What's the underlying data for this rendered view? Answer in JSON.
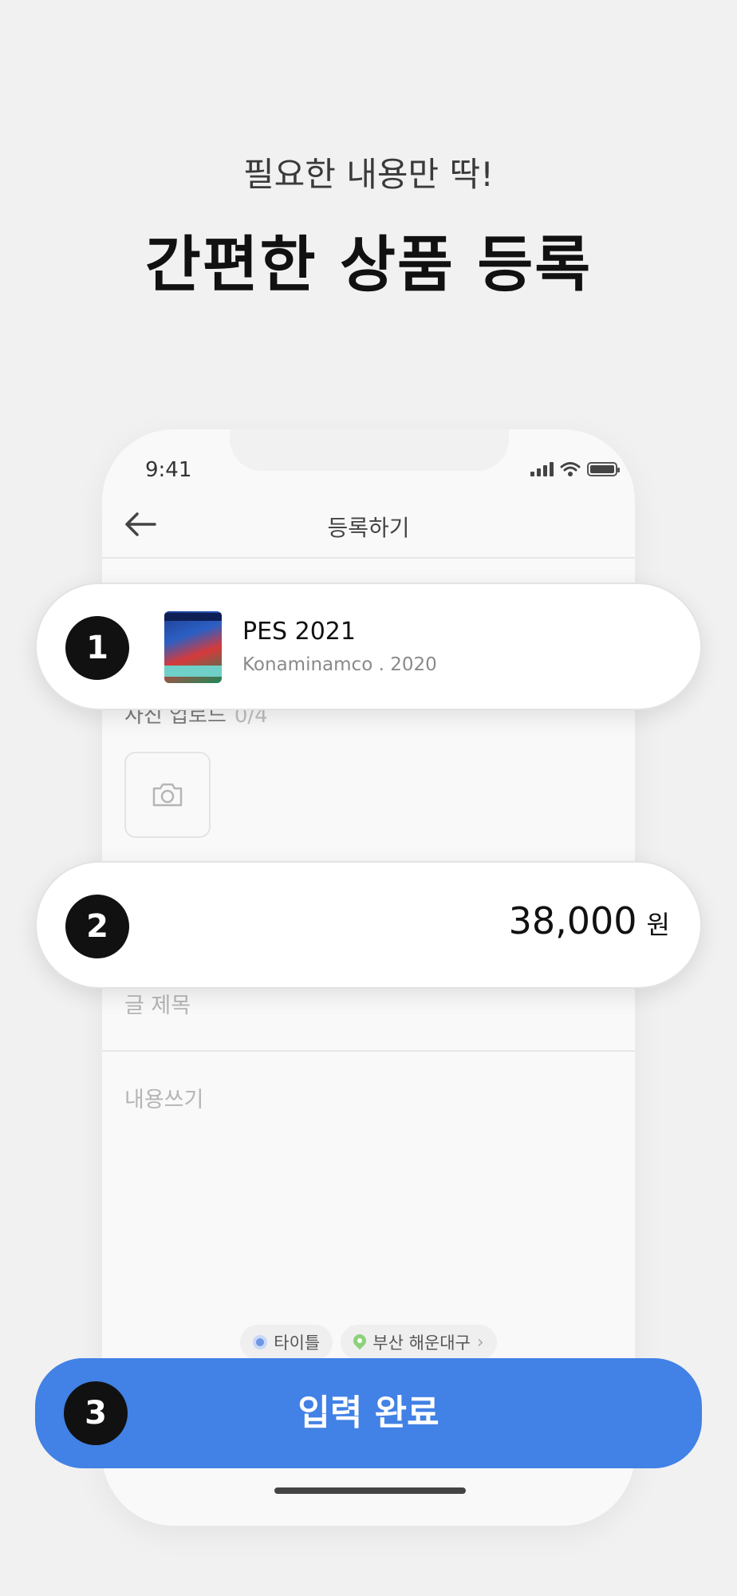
{
  "header": {
    "subtitle": "필요한 내용만 딱!",
    "title": "간편한 상품 등록"
  },
  "phone": {
    "status_time": "9:41",
    "nav_back_icon": "arrow-left-icon",
    "nav_title": "등록하기",
    "photo_label": "사진 업로드",
    "photo_count": "0/4",
    "title_placeholder": "글 제목",
    "content_placeholder": "내용쓰기",
    "chips": [
      {
        "label": "타이틀",
        "icon": "target-dot-icon"
      },
      {
        "label": "부산 해운대구",
        "icon": "location-pin-icon"
      }
    ]
  },
  "step1": {
    "badge": "1",
    "game_name": "PES 2021",
    "game_meta": "Konaminamco . 2020"
  },
  "step2": {
    "badge": "2",
    "price": "38,000",
    "currency": "원"
  },
  "step3": {
    "badge": "3",
    "label": "입력 완료"
  },
  "colors": {
    "accent": "#4281e5",
    "background": "#f1f1f1",
    "badge": "#111111"
  }
}
